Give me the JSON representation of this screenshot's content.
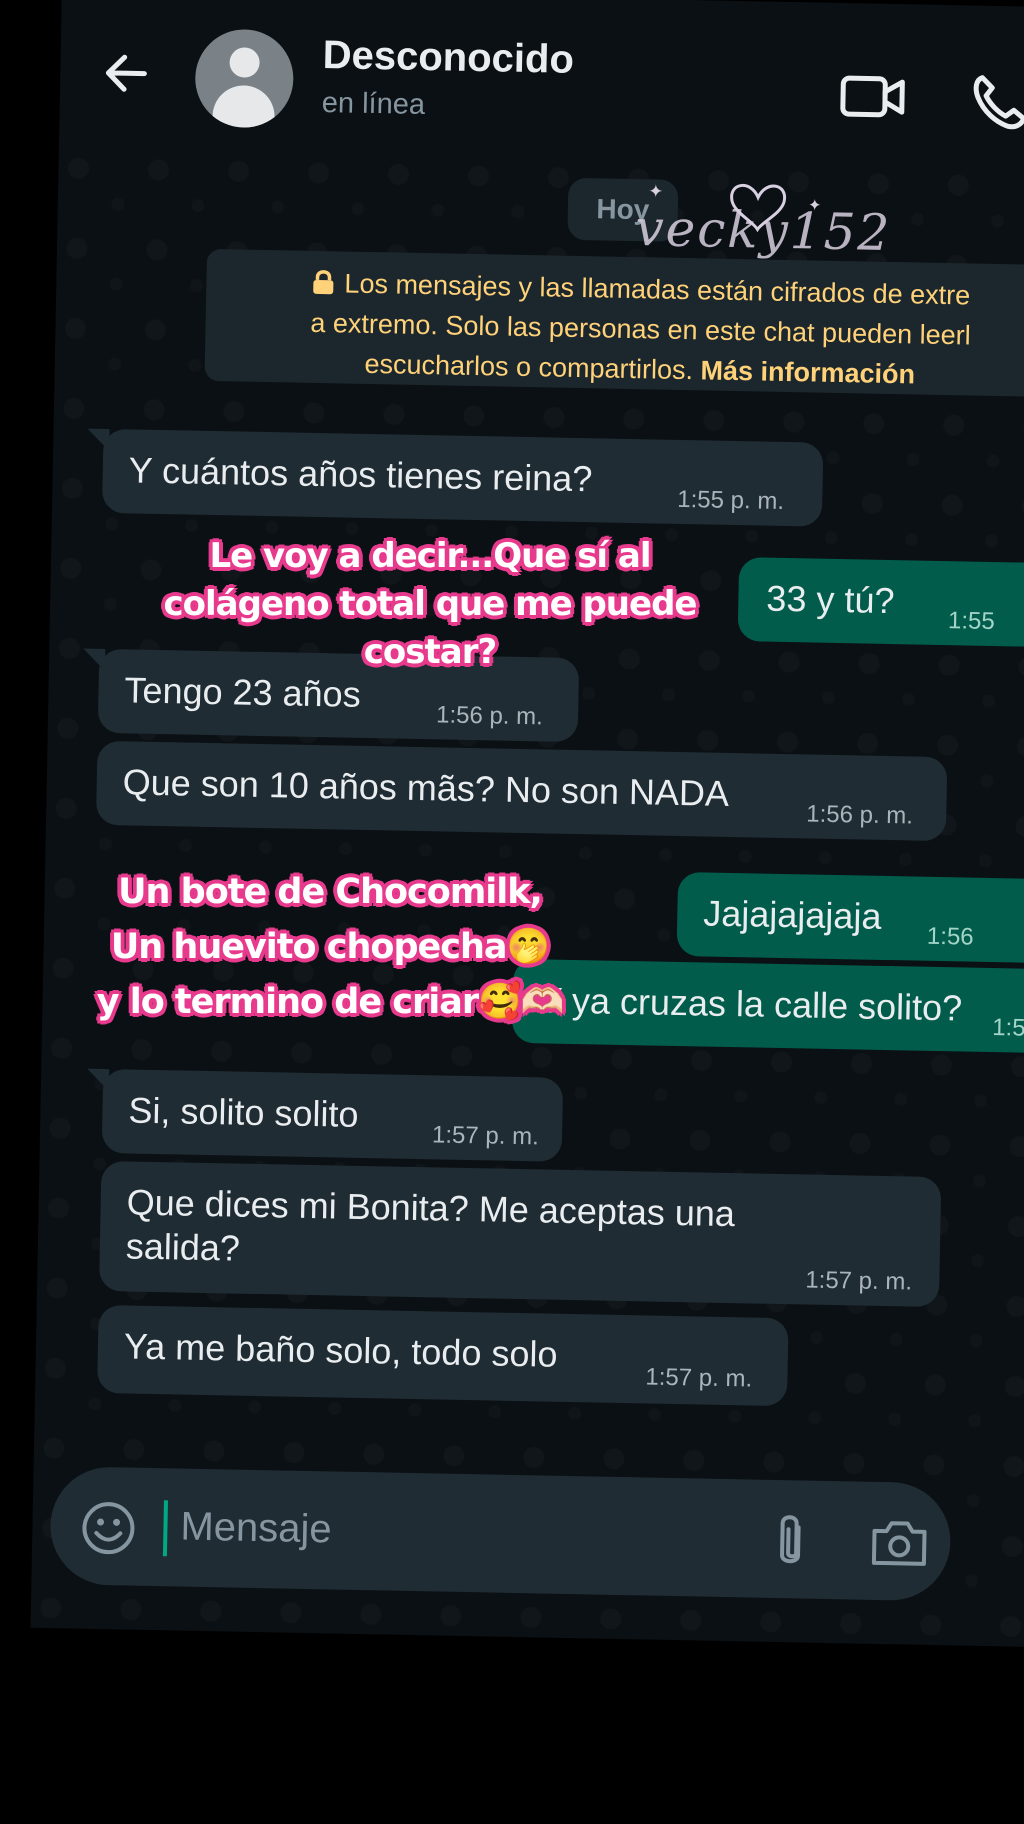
{
  "header": {
    "contact_name": "Desconocido",
    "status": "en línea"
  },
  "day_chip": "Hoy",
  "watermark": "vecky152",
  "encryption": {
    "line1": "Los mensajes y las llamadas están cifrados de extre",
    "line2": "a extremo. Solo las personas en este chat pueden leerl",
    "line3_text": "escucharlos o compartirlos. ",
    "line3_link": "Más información"
  },
  "messages": [
    {
      "dir": "in",
      "text": "Y cuántos años tienes reina?",
      "time": "1:55 p. m."
    },
    {
      "dir": "out",
      "text": "33 y tú?",
      "time": "1:55"
    },
    {
      "dir": "in",
      "text": "Tengo 23 años",
      "time": "1:56 p. m."
    },
    {
      "dir": "in",
      "text": "Que son 10 años mãs? No son NADA",
      "time": "1:56 p. m."
    },
    {
      "dir": "out",
      "text": "Jajajajajaja",
      "time": "1:56"
    },
    {
      "dir": "out",
      "text": "Y ya cruzas la calle solito?",
      "time": "1:5"
    },
    {
      "dir": "in",
      "text": "Si, solito solito",
      "time": "1:57 p. m."
    },
    {
      "dir": "in",
      "text_line1": "Que dices mi Bonita? Me aceptas una",
      "text_line2": "salida?",
      "time": "1:57 p. m."
    },
    {
      "dir": "in",
      "text": "Ya me baño solo, todo solo",
      "time": "1:57 p. m."
    }
  ],
  "overlay_text": {
    "top": [
      "Le voy a decir...Que sí al",
      "colágeno total que me puede",
      "costar?"
    ],
    "bottom": [
      "Un bote de Chocomilk,",
      "Un huevito chopecha🤭",
      "y lo termino de criar🥰🫶🏻"
    ]
  },
  "composer": {
    "placeholder": "Mensaje"
  }
}
